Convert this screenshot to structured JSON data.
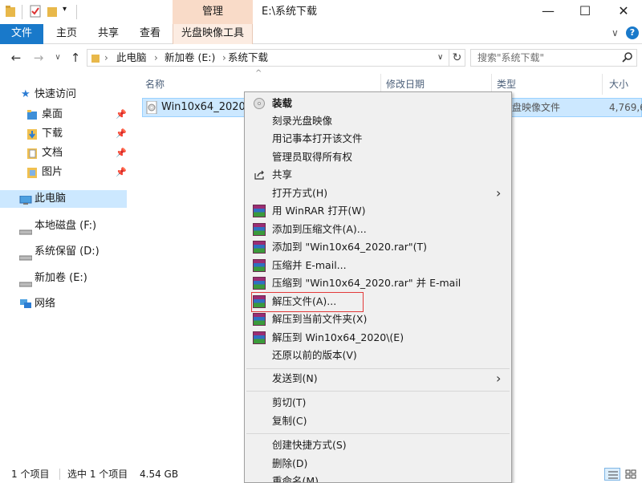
{
  "titlebar": {
    "manage_tab": "管理",
    "window_title": "E:\\系统下载",
    "controls": [
      "—",
      "☐",
      "✕"
    ]
  },
  "ribbon": {
    "file_tab": "文件",
    "tabs": [
      "主页",
      "共享",
      "查看"
    ],
    "disc_tools_tab": "光盘映像工具",
    "collapse": "∨",
    "help": "?"
  },
  "address": {
    "back": "←",
    "forward": "→",
    "recent": "∨",
    "up": "↑",
    "crumbs": [
      "此电脑",
      "新加卷 (E:)",
      "系统下载"
    ],
    "sep": "›",
    "dropdown": "∨",
    "refresh": "↻",
    "search_placeholder": "搜索\"系统下载\""
  },
  "sidebar": {
    "quick_access": "快速访问",
    "pinned": [
      "桌面",
      "下载",
      "文档",
      "图片"
    ],
    "this_pc": "此电脑",
    "drives": [
      "本地磁盘 (F:)",
      "系统保留 (D:)",
      "新加卷 (E:)"
    ],
    "network": "网络"
  },
  "columns": {
    "name": "名称",
    "modified": "修改日期",
    "type": "类型",
    "size": "大小"
  },
  "file": {
    "name": "Win10x64_2020",
    "type": "盘映像文件",
    "size": "4,769,6"
  },
  "context_menu": {
    "items": [
      {
        "label": "装载",
        "icon": "disc-icon",
        "bold": true
      },
      {
        "label": "刻录光盘映像"
      },
      {
        "label": "用记事本打开该文件"
      },
      {
        "label": "管理员取得所有权"
      },
      {
        "label": "共享",
        "icon": "share-icon"
      },
      {
        "label": "打开方式(H)",
        "arrow": true
      },
      {
        "label": "用 WinRAR 打开(W)",
        "icon": "winrar-icon"
      },
      {
        "label": "添加到压缩文件(A)...",
        "icon": "winrar-icon"
      },
      {
        "label": "添加到 \"Win10x64_2020.rar\"(T)",
        "icon": "winrar-icon"
      },
      {
        "label": "压缩并 E-mail...",
        "icon": "winrar-icon"
      },
      {
        "label": "压缩到 \"Win10x64_2020.rar\" 并 E-mail",
        "icon": "winrar-icon"
      },
      {
        "label": "解压文件(A)...",
        "icon": "winrar-icon",
        "highlighted": true
      },
      {
        "label": "解压到当前文件夹(X)",
        "icon": "winrar-icon"
      },
      {
        "label": "解压到 Win10x64_2020\\(E)",
        "icon": "winrar-icon"
      },
      {
        "label": "还原以前的版本(V)"
      },
      {
        "label": "发送到(N)",
        "arrow": true
      },
      {
        "label": "剪切(T)"
      },
      {
        "label": "复制(C)"
      },
      {
        "label": "创建快捷方式(S)"
      },
      {
        "label": "删除(D)"
      },
      {
        "label": "重命名(M)"
      }
    ]
  },
  "status": {
    "count": "1 个项目",
    "selected": "选中 1 个项目",
    "size": "4.54 GB"
  }
}
